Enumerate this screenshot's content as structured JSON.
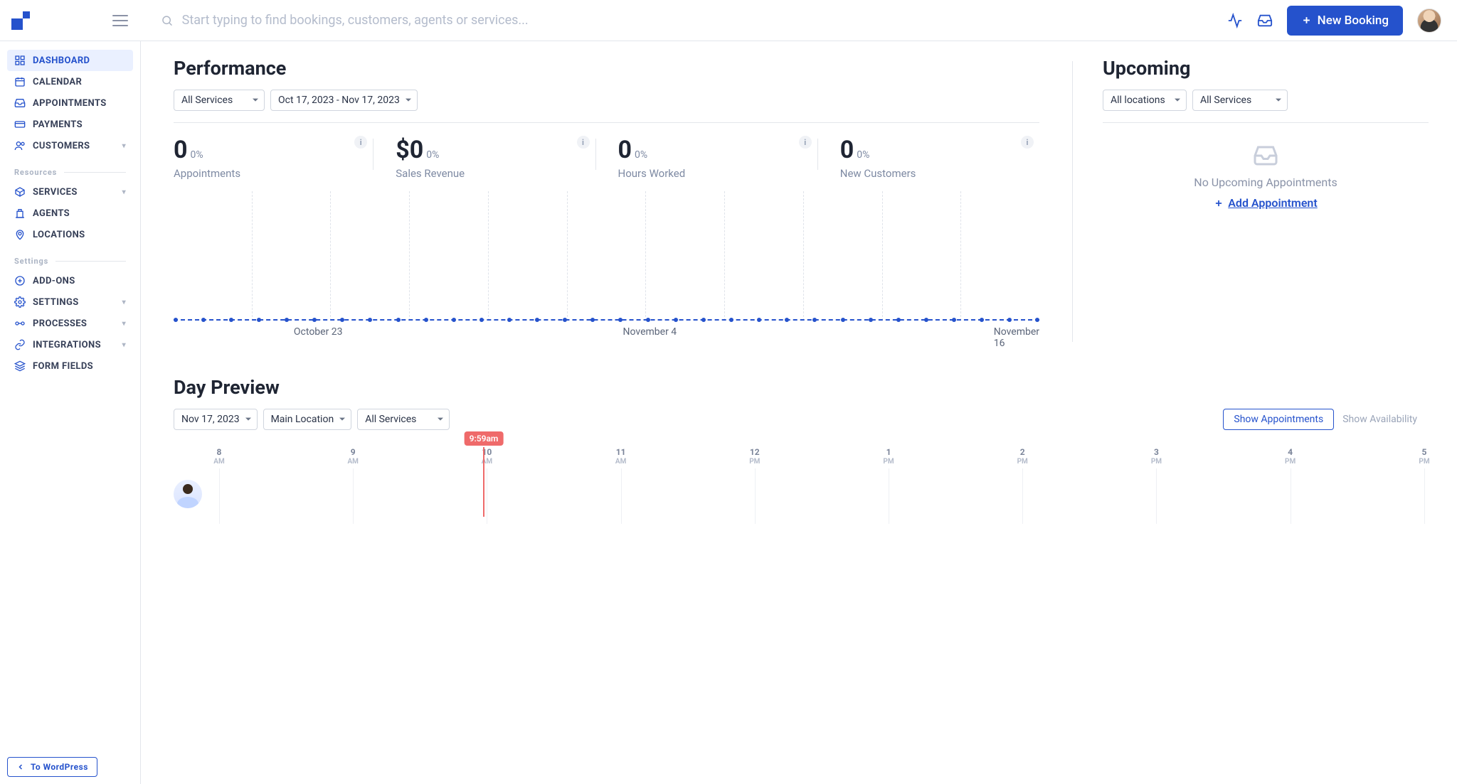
{
  "header": {
    "search_placeholder": "Start typing to find bookings, customers, agents or services...",
    "new_booking_label": "New Booking"
  },
  "sidebar": {
    "nav": [
      {
        "key": "dashboard",
        "label": "Dashboard",
        "active": true
      },
      {
        "key": "calendar",
        "label": "Calendar"
      },
      {
        "key": "appointments",
        "label": "Appointments"
      },
      {
        "key": "payments",
        "label": "Payments"
      },
      {
        "key": "customers",
        "label": "Customers",
        "chev": true
      }
    ],
    "section_resources": "Resources",
    "resources": [
      {
        "key": "services",
        "label": "Services",
        "chev": true
      },
      {
        "key": "agents",
        "label": "Agents"
      },
      {
        "key": "locations",
        "label": "Locations"
      }
    ],
    "section_settings": "Settings",
    "settings": [
      {
        "key": "addons",
        "label": "Add-ons"
      },
      {
        "key": "settings",
        "label": "Settings",
        "chev": true
      },
      {
        "key": "processes",
        "label": "Processes",
        "chev": true
      },
      {
        "key": "integrations",
        "label": "Integrations",
        "chev": true
      },
      {
        "key": "formfields",
        "label": "Form Fields"
      }
    ],
    "to_wordpress": "To WordPress"
  },
  "performance": {
    "title": "Performance",
    "filter_services": "All Services",
    "filter_daterange": "Oct 17, 2023 - Nov 17, 2023",
    "stats": [
      {
        "key": "appointments",
        "value": "0",
        "pct": "0%",
        "label": "Appointments"
      },
      {
        "key": "revenue",
        "value": "$0",
        "pct": "0%",
        "label": "Sales Revenue"
      },
      {
        "key": "hours",
        "value": "0",
        "pct": "0%",
        "label": "Hours Worked"
      },
      {
        "key": "customers",
        "value": "0",
        "pct": "0%",
        "label": "New Customers"
      }
    ],
    "chart_xaxis": [
      {
        "pos": 16.7,
        "label": "October 23"
      },
      {
        "pos": 55.0,
        "label": "November 4"
      },
      {
        "pos": 100,
        "label": "November 16"
      }
    ]
  },
  "upcoming": {
    "title": "Upcoming",
    "filter_locations": "All locations",
    "filter_services": "All Services",
    "empty_text": "No Upcoming Appointments",
    "add_label": "Add Appointment"
  },
  "daypreview": {
    "title": "Day Preview",
    "filter_date": "Nov 17, 2023",
    "filter_location": "Main Location",
    "filter_services": "All Services",
    "btn_appointments": "Show Appointments",
    "btn_availability": "Show Availability",
    "now_label": "9:59am",
    "now_pos": 21.9,
    "hours": [
      {
        "h": "8",
        "m": "AM",
        "pos": 0
      },
      {
        "h": "9",
        "m": "AM",
        "pos": 11.11
      },
      {
        "h": "10",
        "m": "AM",
        "pos": 22.22
      },
      {
        "h": "11",
        "m": "AM",
        "pos": 33.33
      },
      {
        "h": "12",
        "m": "PM",
        "pos": 44.44
      },
      {
        "h": "1",
        "m": "PM",
        "pos": 55.55
      },
      {
        "h": "2",
        "m": "PM",
        "pos": 66.66
      },
      {
        "h": "3",
        "m": "PM",
        "pos": 77.77
      },
      {
        "h": "4",
        "m": "PM",
        "pos": 88.88
      },
      {
        "h": "5",
        "m": "PM",
        "pos": 100
      }
    ]
  },
  "chart_data": {
    "type": "line",
    "title": "Performance",
    "x_start": "Oct 17, 2023",
    "x_end": "Nov 17, 2023",
    "x_ticks": [
      "October 23",
      "November 4",
      "November 16"
    ],
    "series": [
      {
        "name": "Appointments",
        "values_all_zero": true
      }
    ],
    "ylim": [
      0,
      1
    ],
    "note": "All points at 0 across the full date range"
  }
}
